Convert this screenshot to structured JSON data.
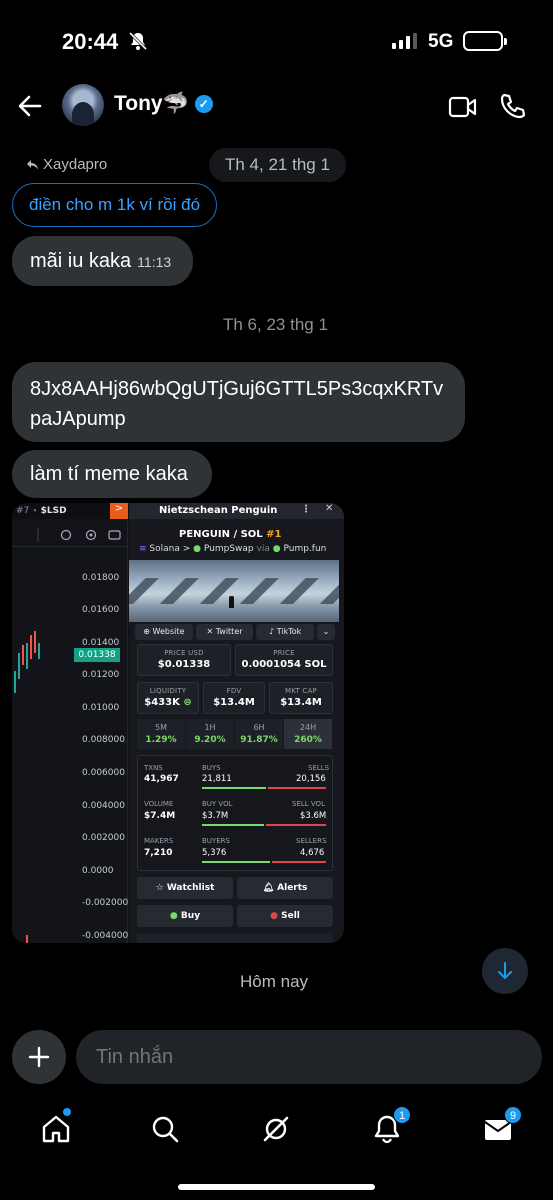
{
  "status_bar": {
    "time": "20:44",
    "network": "5G"
  },
  "header": {
    "name": "Tony🦈",
    "verified": true
  },
  "chat": {
    "date1": "Th 4, 21 thg 1",
    "reply_to": "Xaydapro",
    "quoted_text": "điền cho m 1k ví rồi đó",
    "msg1": {
      "text": "mãi iu kaka",
      "time": "11:13"
    },
    "date2": "Th 6, 23 thg 1",
    "msg2": "8Jx8AAHj86wbQgUTjGuj6GTTL5Ps3cqxKRTvpaJApump",
    "msg3": "làm tí meme kaka",
    "today": "Hôm nay"
  },
  "screenshot": {
    "chart_top": "#7",
    "ticker": "$LSD",
    "chart_button": ">",
    "window_title": "Nietzschean Penguin",
    "pair": "PENGUIN",
    "quote": "/ SOL",
    "rank": "#1",
    "chain": "Solana",
    "dex": "PumpSwap",
    "via": "via",
    "launchpad": "Pump.fun",
    "y_ticks": [
      "0.01800",
      "0.01600",
      "0.01400",
      "0.01200",
      "0.01000",
      "0.008000",
      "0.006000",
      "0.004000",
      "0.002000",
      "0.0000",
      "-0.002000",
      "-0.004000"
    ],
    "current_price": "0.01338",
    "socials": [
      "Website",
      "Twitter",
      "TikTok"
    ],
    "price_usd_label": "PRICE USD",
    "price_usd": "$0.01338",
    "price_label": "PRICE",
    "price_sol": "0.0001054 SOL",
    "liquidity_label": "LIQUIDITY",
    "liquidity": "$433K",
    "fdv_label": "FDV",
    "fdv": "$13.4M",
    "mktcap_label": "MKT CAP",
    "mktcap": "$13.4M",
    "timeframes": [
      {
        "k": "5M",
        "v": "1.29%"
      },
      {
        "k": "1H",
        "v": "9.20%"
      },
      {
        "k": "6H",
        "v": "91.87%"
      },
      {
        "k": "24H",
        "v": "260%"
      }
    ],
    "txns_label": "TXNS",
    "txns": "41,967",
    "buys_label": "BUYS",
    "buys": "21,811",
    "sells_label": "SELLS",
    "sells": "20,156",
    "volume_label": "VOLUME",
    "volume": "$7.4M",
    "buyvol_label": "BUY VOL",
    "buyvol": "$3.7M",
    "sellvol_label": "SELL VOL",
    "sellvol": "$3.6M",
    "makers_label": "MAKERS",
    "makers": "7,210",
    "buyers_label": "BUYERS",
    "buyers": "5,376",
    "sellers_label": "SELLERS",
    "sellers": "4,676",
    "watchlist": "Watchlist",
    "alerts": "Alerts",
    "buy": "Buy",
    "sell": "Sell"
  },
  "composer": {
    "placeholder": "Tin nhắn"
  },
  "tabbar": {
    "notifications_badge": "1",
    "messages_badge": "9"
  },
  "colors": {
    "accent": "#1d9bf0",
    "bubble": "#2f3336",
    "positive": "#7bd96a",
    "negative": "#e0454b"
  }
}
